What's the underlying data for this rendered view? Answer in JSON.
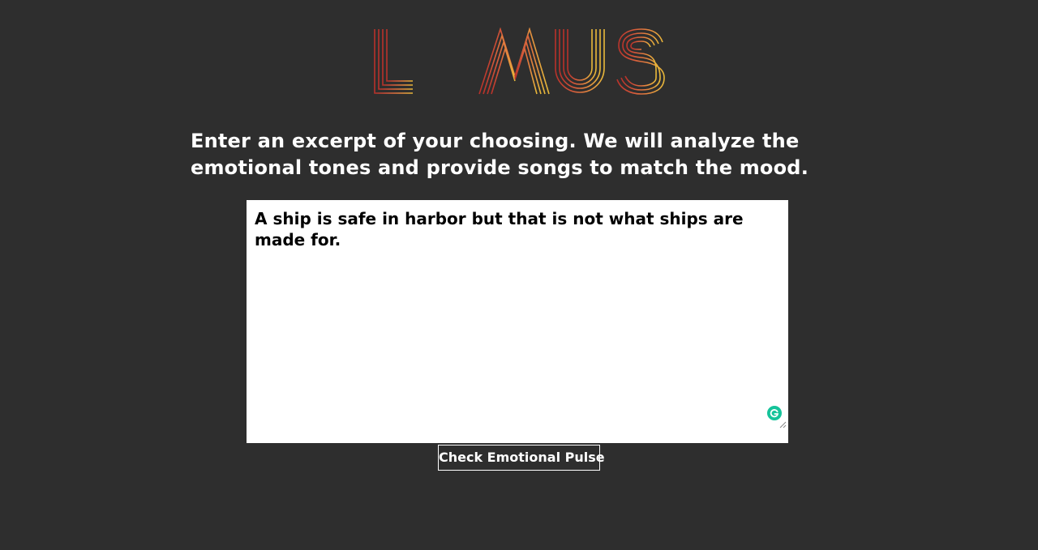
{
  "logo": {
    "text": "LITMUS",
    "colors": [
      "#c0392b",
      "#d4553a",
      "#e0703f",
      "#e68a3e",
      "#e8a53c",
      "#e8bb3a"
    ]
  },
  "intro": {
    "text": "Enter an excerpt of your choosing. We will analyze the emotional tones and provide songs to match the mood."
  },
  "excerpt": {
    "value": "A ship is safe in harbor but that is not what ships are made for."
  },
  "icons": {
    "grammarly": "grammarly-icon",
    "resize": "resize-handle-icon"
  },
  "submit": {
    "label": "Check Emotional Pulse"
  },
  "theme": {
    "background": "#2e2e2e",
    "grammarly_green": "#15c39a"
  }
}
